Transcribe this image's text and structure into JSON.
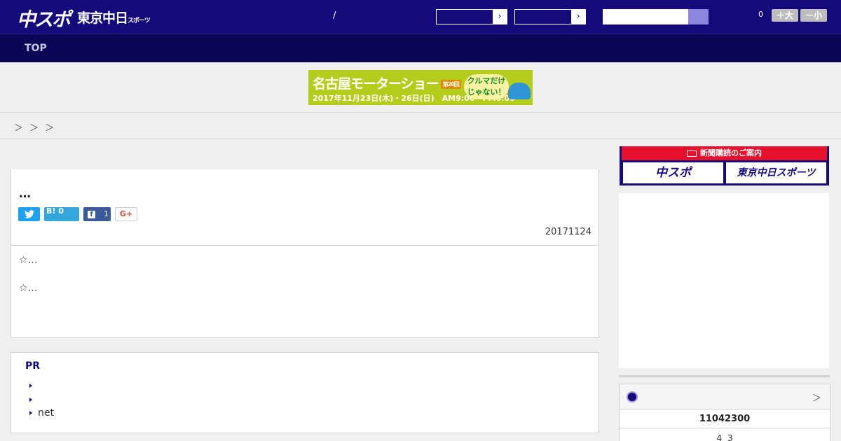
{
  "header": {
    "logo_main": "中スポ",
    "logo_sub": "東京中日",
    "logo_sub_small": "スポーツ",
    "separator": "/",
    "select_arrow_icon": "chevron-right-icon",
    "counter": "0",
    "font_larger": "＋大",
    "font_smaller": "－小",
    "colors": {
      "header_bg": "#150a7b",
      "nav_bg": "#0c0656",
      "search_button": "#8d84e0"
    }
  },
  "nav": {
    "items": [
      {
        "label": "TOP"
      }
    ]
  },
  "banner": {
    "title": "名古屋モーターショー",
    "edition": "第20回",
    "dates": "2017年11月23日(木)・26日(日)　AM9:00〜PM6:00",
    "tagline": "クルマだけじゃない！"
  },
  "breadcrumb": {
    "text": "＞ ＞ ＞"
  },
  "article": {
    "title": "…",
    "accent_colors": {
      "red": "#e8112d",
      "purple": "#6659c9"
    },
    "share": {
      "twitter_icon": "twitter-icon",
      "hatena_label": "B!",
      "hatena_count": "0",
      "facebook_icon": "facebook-icon",
      "facebook_count": "1",
      "google_label": "G+"
    },
    "date": "20171124",
    "paragraphs": [
      "☆…",
      "☆…"
    ]
  },
  "pr": {
    "heading": "PR",
    "items": [
      "",
      "",
      "net"
    ]
  },
  "sidebar": {
    "subscription": {
      "header": "新聞購読のご案内",
      "option1": "中スポ",
      "option2": "東京中日スポーツ"
    },
    "score": {
      "icon": "baseball-icon",
      "more": "＞",
      "date": "11042300",
      "result": "4  3"
    }
  }
}
